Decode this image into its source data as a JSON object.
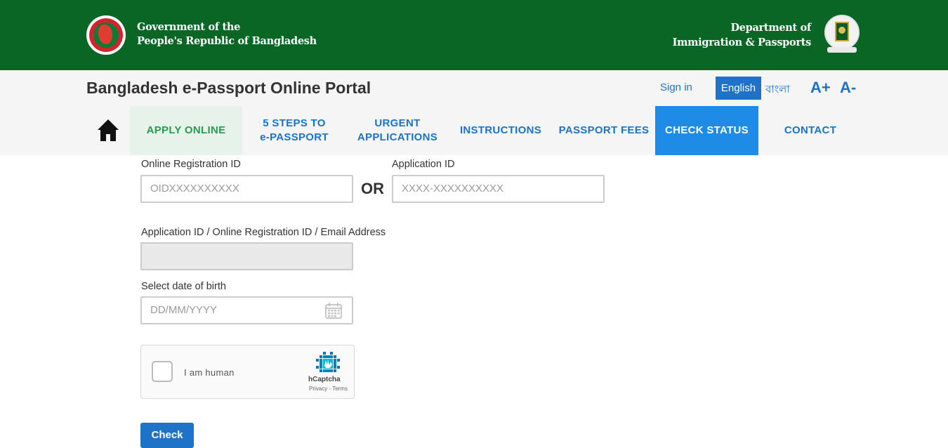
{
  "header": {
    "gov_line1": "Government of the",
    "gov_line2": "People's Republic of Bangladesh",
    "dept_line1": "Department of",
    "dept_line2": "Immigration & Passports",
    "bg_color": "#0a6624"
  },
  "portal": {
    "title": "Bangladesh e-Passport Online Portal",
    "sign_in": "Sign in",
    "lang_english": "English",
    "lang_bangla": "বাংলা",
    "font_increase": "A+",
    "font_decrease": "A-"
  },
  "nav": {
    "home_icon": "home-icon",
    "items": [
      {
        "line1": "APPLY ONLINE",
        "line2": ""
      },
      {
        "line1": "5 STEPS TO",
        "line2": "e-PASSPORT"
      },
      {
        "line1": "URGENT",
        "line2": "APPLICATIONS"
      },
      {
        "line1": "INSTRUCTIONS",
        "line2": ""
      },
      {
        "line1": "PASSPORT FEES",
        "line2": ""
      },
      {
        "line1": "CHECK STATUS",
        "line2": ""
      },
      {
        "line1": "CONTACT",
        "line2": ""
      }
    ],
    "active": "CHECK STATUS"
  },
  "form": {
    "oid_label": "Online Registration ID",
    "oid_placeholder": "OIDXXXXXXXXXX",
    "or_text": "OR",
    "app_id_label": "Application ID",
    "app_id_placeholder": "XXXX-XXXXXXXXXX",
    "combined_label": "Application ID / Online Registration ID / Email Address",
    "combined_value": "",
    "dob_label": "Select date of birth",
    "dob_placeholder": "DD/MM/YYYY",
    "calendar_icon": "calendar-icon",
    "captcha_text": "I am human",
    "captcha_brand": "hCaptcha",
    "captcha_links": "Privacy - Terms",
    "submit_label": "Check"
  }
}
